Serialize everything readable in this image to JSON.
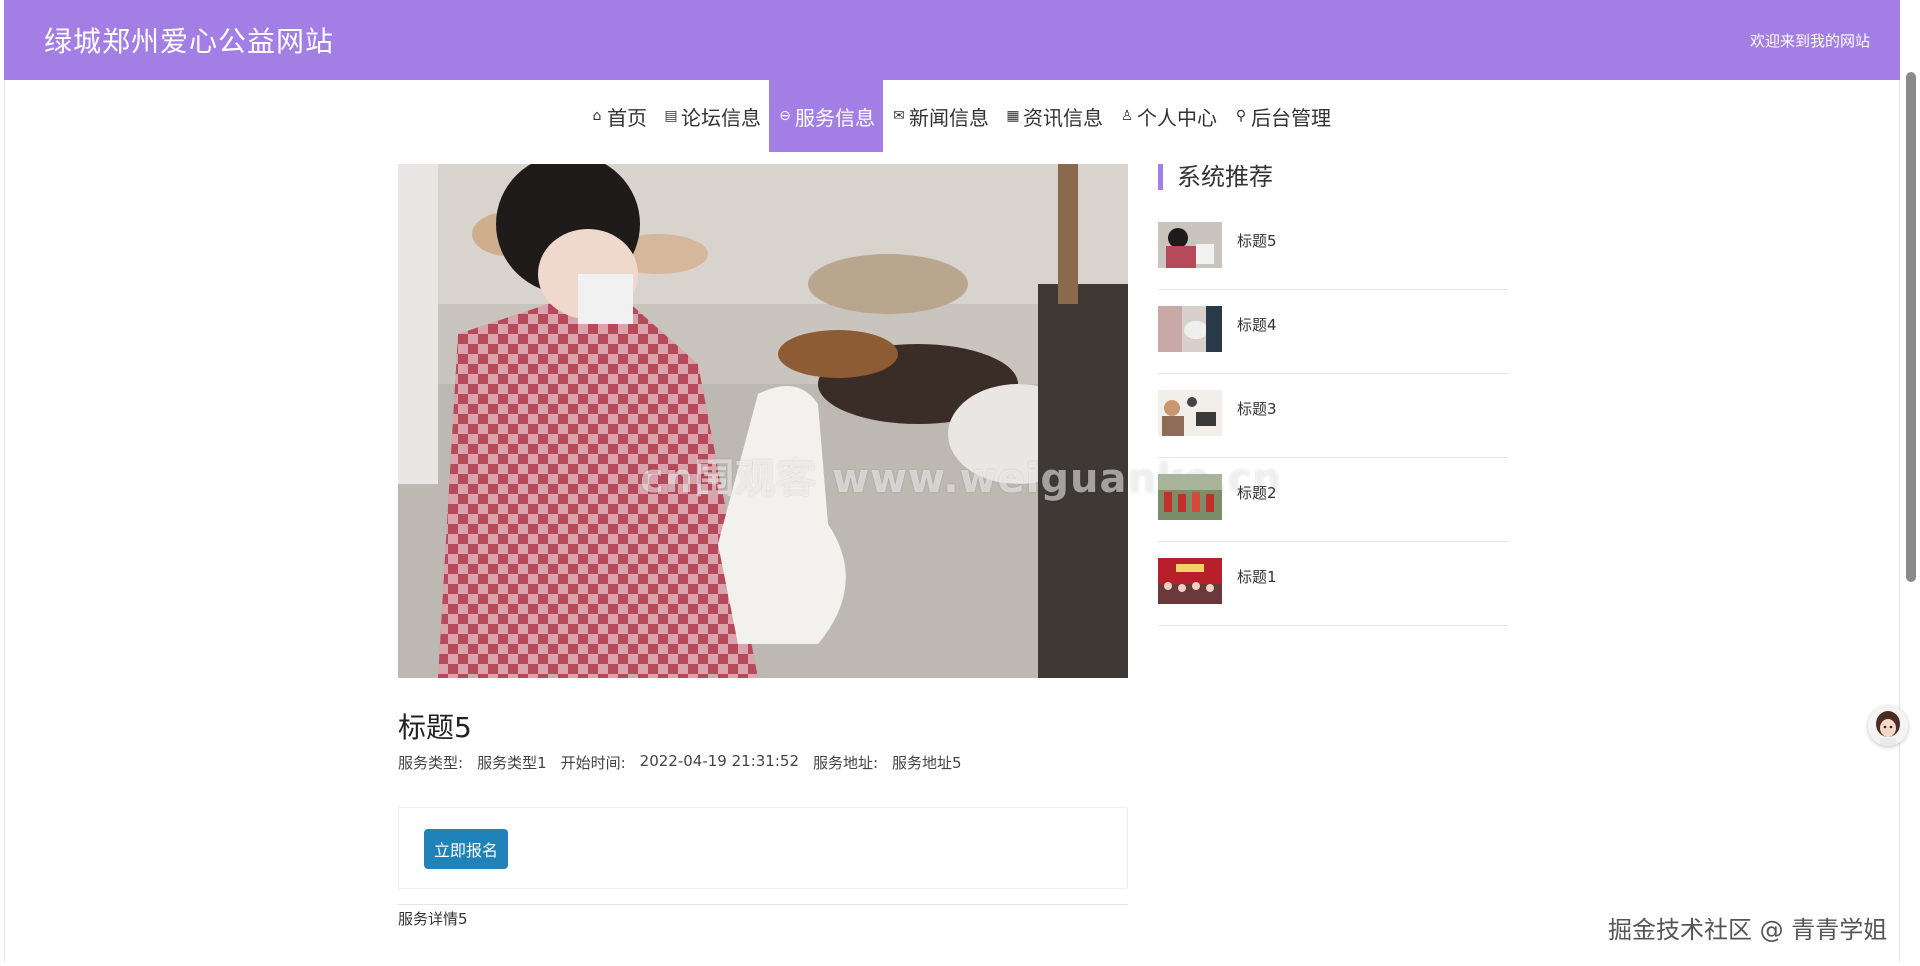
{
  "header": {
    "site_title": "绿城郑州爱心公益网站",
    "welcome": "欢迎来到我的网站",
    "bg_color": "#a37ee4"
  },
  "nav": {
    "items": [
      {
        "label": "首页",
        "icon": "home-icon",
        "active": false
      },
      {
        "label": "论坛信息",
        "icon": "clipboard-icon",
        "active": false
      },
      {
        "label": "服务信息",
        "icon": "service-icon",
        "active": true
      },
      {
        "label": "新闻信息",
        "icon": "mail-icon",
        "active": false
      },
      {
        "label": "资讯信息",
        "icon": "calendar-icon",
        "active": false
      },
      {
        "label": "个人中心",
        "icon": "user-icon",
        "active": false
      },
      {
        "label": "后台管理",
        "icon": "link-icon",
        "active": false
      }
    ]
  },
  "detail": {
    "watermark": "cn围观客 www.weiguanke.cn",
    "title": "标题5",
    "meta": {
      "type_label": "服务类型:",
      "type_value": "服务类型1",
      "start_label": "开始时间:",
      "start_value": "2022-04-19 21:31:52",
      "address_label": "服务地址:",
      "address_value": "服务地址5"
    },
    "apply_label": "立即报名",
    "body": "服务详情5"
  },
  "sidebar": {
    "title": "系统推荐",
    "items": [
      {
        "label": "标题5"
      },
      {
        "label": "标题4"
      },
      {
        "label": "标题3"
      },
      {
        "label": "标题2"
      },
      {
        "label": "标题1"
      }
    ]
  },
  "footer_mark": "掘金技术社区 @ 青青学姐"
}
